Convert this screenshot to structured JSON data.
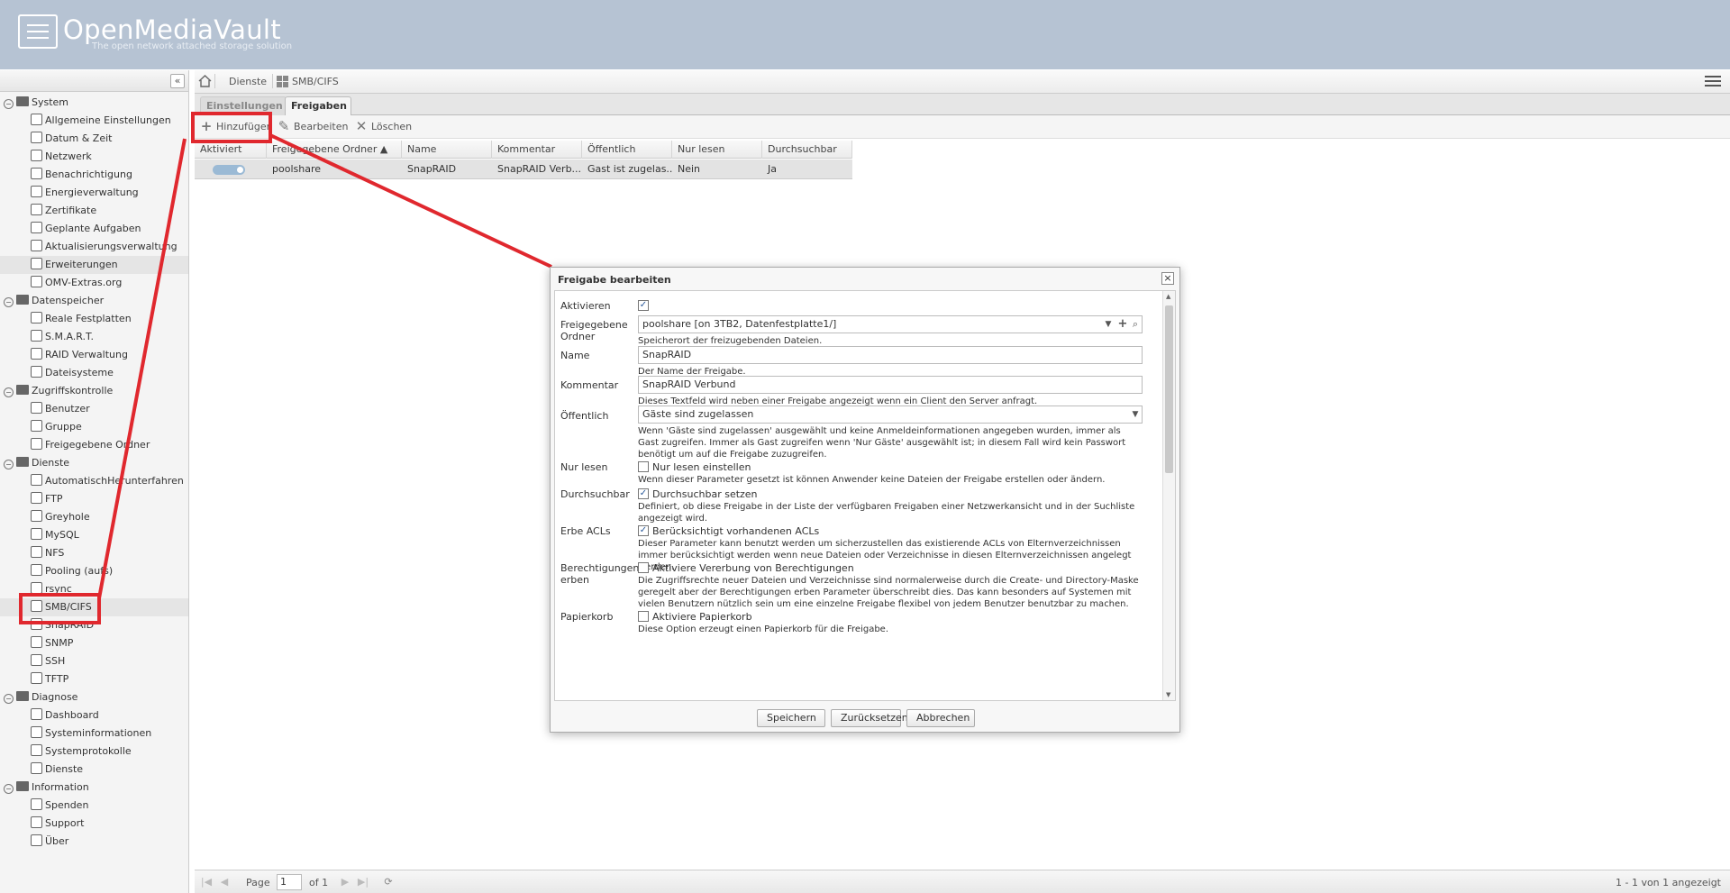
{
  "header": {
    "app_name": "OpenMediaVault",
    "tagline": "The open network attached storage solution"
  },
  "sidebar": {
    "collapse_label": "«",
    "items": [
      {
        "label": "System",
        "type": "category"
      },
      {
        "label": "Allgemeine Einstellungen",
        "type": "item"
      },
      {
        "label": "Datum & Zeit",
        "type": "item"
      },
      {
        "label": "Netzwerk",
        "type": "item"
      },
      {
        "label": "Benachrichtigung",
        "type": "item"
      },
      {
        "label": "Energieverwaltung",
        "type": "item"
      },
      {
        "label": "Zertifikate",
        "type": "item"
      },
      {
        "label": "Geplante Aufgaben",
        "type": "item"
      },
      {
        "label": "Aktualisierungsverwaltung",
        "type": "item"
      },
      {
        "label": "Erweiterungen",
        "type": "item"
      },
      {
        "label": "OMV-Extras.org",
        "type": "item"
      },
      {
        "label": "Datenspeicher",
        "type": "category"
      },
      {
        "label": "Reale Festplatten",
        "type": "item"
      },
      {
        "label": "S.M.A.R.T.",
        "type": "item"
      },
      {
        "label": "RAID Verwaltung",
        "type": "item"
      },
      {
        "label": "Dateisysteme",
        "type": "item"
      },
      {
        "label": "Zugriffskontrolle",
        "type": "category"
      },
      {
        "label": "Benutzer",
        "type": "item"
      },
      {
        "label": "Gruppe",
        "type": "item"
      },
      {
        "label": "Freigegebene Ordner",
        "type": "item"
      },
      {
        "label": "Dienste",
        "type": "category"
      },
      {
        "label": "AutomatischHerunterfahren",
        "type": "item"
      },
      {
        "label": "FTP",
        "type": "item"
      },
      {
        "label": "Greyhole",
        "type": "item"
      },
      {
        "label": "MySQL",
        "type": "item"
      },
      {
        "label": "NFS",
        "type": "item"
      },
      {
        "label": "Pooling (aufs)",
        "type": "item"
      },
      {
        "label": "rsync",
        "type": "item"
      },
      {
        "label": "SMB/CIFS",
        "type": "item"
      },
      {
        "label": "SnapRAID",
        "type": "item"
      },
      {
        "label": "SNMP",
        "type": "item"
      },
      {
        "label": "SSH",
        "type": "item"
      },
      {
        "label": "TFTP",
        "type": "item"
      },
      {
        "label": "Diagnose",
        "type": "category"
      },
      {
        "label": "Dashboard",
        "type": "item"
      },
      {
        "label": "Systeminformationen",
        "type": "item"
      },
      {
        "label": "Systemprotokolle",
        "type": "item"
      },
      {
        "label": "Dienste",
        "type": "item"
      },
      {
        "label": "Information",
        "type": "category"
      },
      {
        "label": "Spenden",
        "type": "item"
      },
      {
        "label": "Support",
        "type": "item"
      },
      {
        "label": "Über",
        "type": "item"
      }
    ]
  },
  "breadcrumb": {
    "items": [
      "Dienste",
      "SMB/CIFS"
    ]
  },
  "tabs": [
    {
      "label": "Einstellungen"
    },
    {
      "label": "Freigaben"
    }
  ],
  "toolbar": {
    "add": "Hinzufügen",
    "edit": "Bearbeiten",
    "delete": "Löschen"
  },
  "grid": {
    "columns": [
      "Aktiviert",
      "Freigegebene Ordner ▲",
      "Name",
      "Kommentar",
      "Öffentlich",
      "Nur lesen",
      "Durchsuchbar"
    ],
    "rows": [
      {
        "shared_folder": "poolshare",
        "name": "SnapRAID",
        "comment": "SnapRAID Verb...",
        "public": "Gast ist zugelas...",
        "read_only": "Nein",
        "browsable": "Ja"
      }
    ]
  },
  "pager": {
    "page_label": "Page",
    "page_value": "1",
    "of_label": "of 1",
    "summary": "1 - 1 von 1 angezeigt"
  },
  "dialog": {
    "title": "Freigabe bearbeiten",
    "close": "×",
    "fields": {
      "enable": {
        "label": "Aktivieren",
        "checked_glyph": "✓"
      },
      "shared_folder": {
        "label": "Freigegebene Ordner",
        "value": "poolshare [on 3TB2, Datenfestplatte1/]",
        "hint": "Speicherort der freizugebenden Dateien."
      },
      "name": {
        "label": "Name",
        "value": "SnapRAID",
        "hint": "Der Name der Freigabe."
      },
      "comment": {
        "label": "Kommentar",
        "value": "SnapRAID Verbund",
        "hint": "Dieses Textfeld wird neben einer Freigabe angezeigt wenn ein Client den Server anfragt."
      },
      "public": {
        "label": "Öffentlich",
        "value": "Gäste sind zugelassen",
        "hint": "Wenn 'Gäste sind zugelassen' ausgewählt und keine Anmeldeinformationen angegeben wurden, immer als Gast zugreifen. Immer als Gast zugreifen wenn 'Nur Gäste' ausgewählt ist; in diesem Fall wird kein Passwort benötigt um auf die Freigabe zuzugreifen."
      },
      "read_only": {
        "label": "Nur lesen",
        "cb_label": "Nur lesen einstellen",
        "hint": "Wenn dieser Parameter gesetzt ist können Anwender keine Dateien der Freigabe erstellen oder ändern."
      },
      "browsable": {
        "label": "Durchsuchbar",
        "cb_label": "Durchsuchbar setzen",
        "hint": "Definiert, ob diese Freigabe in der Liste der verfügbaren Freigaben einer Netzwerkansicht und in der Suchliste angezeigt wird."
      },
      "inherit_acls": {
        "label": "Erbe ACLs",
        "cb_label": "Berücksichtigt vorhandenen ACLs",
        "hint": "Dieser Parameter kann benutzt werden um sicherzustellen das existierende ACLs von Elternverzeichnissen immer berücksichtigt werden wenn neue Dateien oder Verzeichnisse in diesen Elternverzeichnissen angelegt werden."
      },
      "inherit_permissions": {
        "label": "Berechtigungen erben",
        "cb_label": "Aktiviere Vererbung von Berechtigungen",
        "hint": "Die Zugriffsrechte neuer Dateien und Verzeichnisse sind normalerweise durch die Create- und Directory-Maske geregelt aber der Berechtigungen erben Parameter überschreibt dies. Das kann besonders auf Systemen mit vielen Benutzern nützlich sein um eine einzelne Freigabe flexibel von jedem Benutzer benutzbar zu machen."
      },
      "recycle_bin": {
        "label": "Papierkorb",
        "cb_label": "Aktiviere Papierkorb",
        "hint": "Diese Option erzeugt einen Papierkorb für die Freigabe."
      }
    },
    "buttons": {
      "save": "Speichern",
      "reset": "Zurücksetzen",
      "cancel": "Abbrechen"
    }
  },
  "colors": {
    "header_bg": "#b6c3d3",
    "annotation": "#e0282e",
    "selection": "#e3e3e3"
  }
}
